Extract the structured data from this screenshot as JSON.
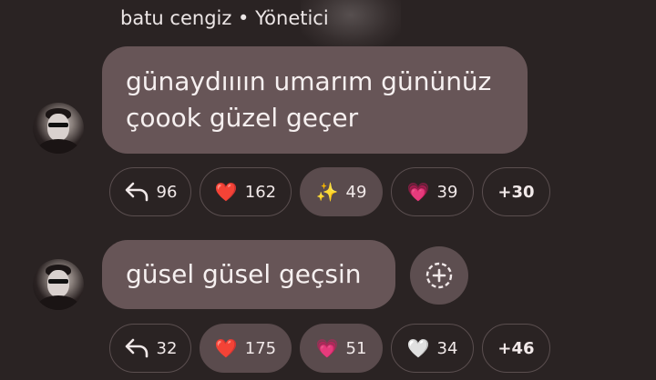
{
  "header": {
    "sender": "batu cengiz • Yönetici"
  },
  "messages": [
    {
      "lines": [
        "günaydıııın umarım gününüz",
        "çoook güzel geçer"
      ],
      "reactions": [
        {
          "type": "reply",
          "icon": "reply-icon",
          "count": "96"
        },
        {
          "type": "emoji",
          "emoji": "❤️",
          "icon": "red-heart-icon",
          "count": "162",
          "selected": false
        },
        {
          "type": "emoji",
          "emoji": "✨",
          "icon": "sparkles-icon",
          "count": "49",
          "selected": true
        },
        {
          "type": "emoji",
          "emoji": "💗",
          "icon": "growing-heart-icon",
          "count": "39",
          "selected": false
        },
        {
          "type": "more",
          "label": "+30"
        }
      ]
    },
    {
      "lines": [
        "güsel güsel geçsin"
      ],
      "add_reaction_icon": "add-reaction-icon",
      "reactions": [
        {
          "type": "reply",
          "icon": "reply-icon",
          "count": "32"
        },
        {
          "type": "emoji",
          "emoji": "❤️",
          "icon": "red-heart-icon",
          "count": "175",
          "selected": true
        },
        {
          "type": "emoji",
          "emoji": "💗",
          "icon": "growing-heart-icon",
          "count": "51",
          "selected": true
        },
        {
          "type": "emoji",
          "emoji": "🤍",
          "icon": "white-heart-icon",
          "count": "34",
          "selected": false
        },
        {
          "type": "more",
          "label": "+46"
        }
      ]
    }
  ],
  "colors": {
    "background": "#2a2323",
    "bubble": "#675557",
    "chip_selected": "#5a4b4d"
  }
}
